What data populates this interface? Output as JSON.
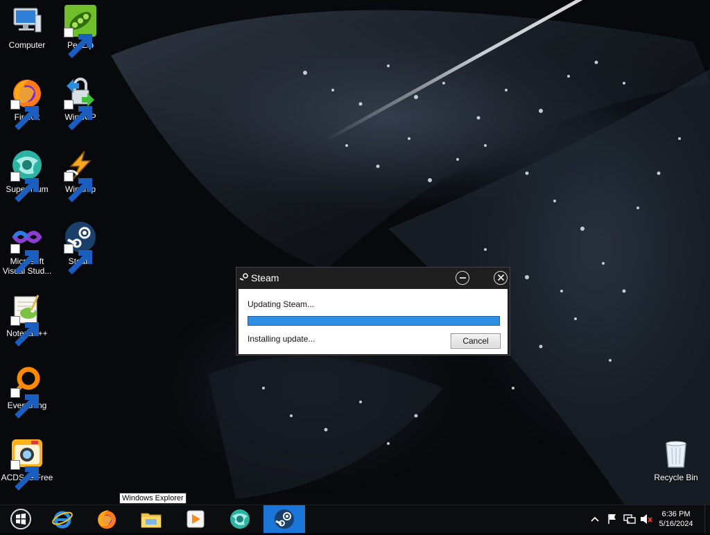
{
  "desktop": {
    "icons": [
      {
        "label": "Computer",
        "icon": "computer-icon"
      },
      {
        "label": "PeaZip",
        "icon": "peazip-icon"
      },
      {
        "label": "Firefox",
        "icon": "firefox-icon"
      },
      {
        "label": "WinSCP",
        "icon": "winscp-icon"
      },
      {
        "label": "Supermium",
        "icon": "supermium-icon"
      },
      {
        "label": "Winamp",
        "icon": "winamp-icon"
      },
      {
        "label": "Microsoft Visual Stud...",
        "icon": "visual-studio-icon"
      },
      {
        "label": "Steam",
        "icon": "steam-icon"
      },
      {
        "label": "Notepad++",
        "icon": "notepadpp-icon"
      },
      {
        "label": "Everything",
        "icon": "everything-icon"
      },
      {
        "label": "ACDSee Free",
        "icon": "acdsee-icon"
      },
      {
        "label": "Recycle Bin",
        "icon": "recycle-bin-icon"
      }
    ]
  },
  "dialog": {
    "title": "Steam",
    "status": "Updating Steam...",
    "detail": "Installing update...",
    "progress": 1.0,
    "cancel_label": "Cancel",
    "accent": "#2d8ee3"
  },
  "tooltip": {
    "text": "Windows Explorer"
  },
  "taskbar": {
    "items": [
      {
        "icon": "start-icon"
      },
      {
        "icon": "internet-explorer-icon"
      },
      {
        "icon": "firefox-icon"
      },
      {
        "icon": "windows-explorer-icon"
      },
      {
        "icon": "media-player-icon"
      },
      {
        "icon": "supermium-icon"
      },
      {
        "icon": "steam-icon",
        "active": true
      }
    ],
    "active_color": "#1b74d8"
  },
  "tray": {
    "icons": [
      "show-hidden-icons-icon",
      "action-center-flag-icon",
      "network-icon",
      "volume-muted-icon"
    ],
    "time": "6:36 PM",
    "date": "5/16/2024"
  }
}
